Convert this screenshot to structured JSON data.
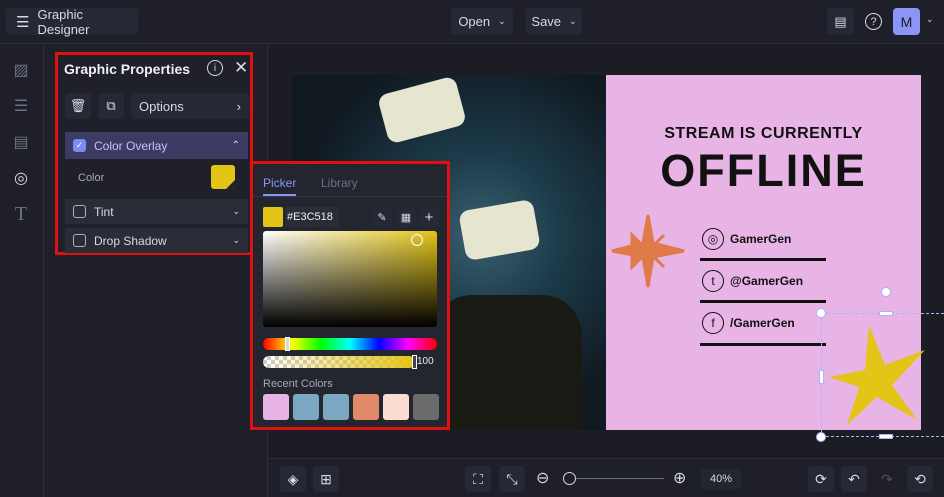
{
  "header": {
    "app_title": "Graphic Designer",
    "open_label": "Open",
    "save_label": "Save",
    "avatar_initial": "M"
  },
  "properties": {
    "title": "Graphic Properties",
    "options_label": "Options",
    "color_overlay_label": "Color Overlay",
    "color_label": "Color",
    "tint_label": "Tint",
    "drop_shadow_label": "Drop Shadow",
    "overlay_color": "#E3C518"
  },
  "picker": {
    "tabs": [
      "Picker",
      "Library"
    ],
    "hex_value": "#E3C518",
    "opacity": "100",
    "recent_label": "Recent Colors",
    "recent_colors": [
      "#e8b4e6",
      "#7aa8c0",
      "#7aa8c0",
      "#e08a6a",
      "#fbdcd0",
      "#6b6b6b"
    ],
    "hue_fraction": 0.14
  },
  "canvas": {
    "headline": "STREAM IS CURRENTLY",
    "title": "OFFLINE",
    "socials": [
      {
        "icon": "instagram-icon",
        "glyph": "◎",
        "handle": "GamerGen"
      },
      {
        "icon": "tumblr-icon",
        "glyph": "t",
        "handle": "@GamerGen"
      },
      {
        "icon": "facebook-icon",
        "glyph": "f",
        "handle": "/GamerGen"
      }
    ]
  },
  "zoom": {
    "level": "40%",
    "fraction": 0.05
  }
}
